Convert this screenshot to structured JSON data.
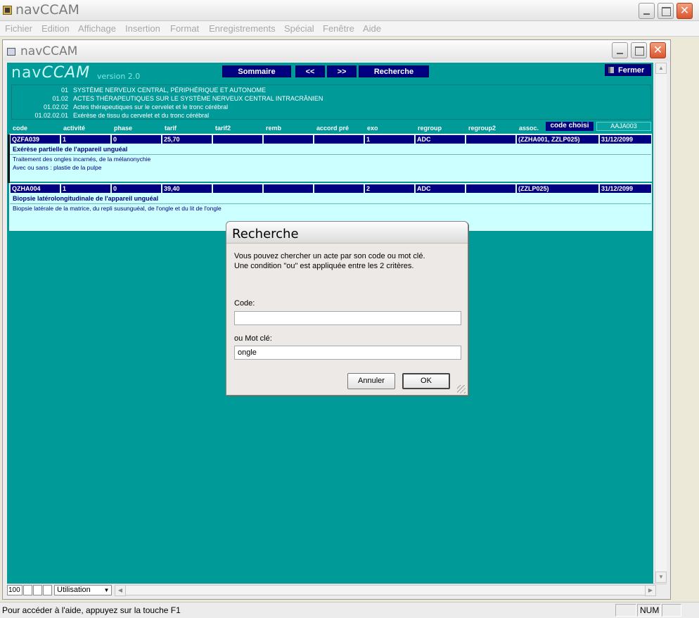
{
  "app": {
    "title": "navCCAM",
    "menu": [
      "Fichier",
      "Edition",
      "Affichage",
      "Insertion",
      "Format",
      "Enregistrements",
      "Spécial",
      "Fenêtre",
      "Aide"
    ]
  },
  "inner": {
    "title": "navCCAM"
  },
  "form": {
    "logo_left": "nav",
    "logo_right": "CCAM",
    "version": "version 2.0",
    "nav": {
      "sommaire": "Sommaire",
      "prev": "<<",
      "next": ">>",
      "recherche": "Recherche"
    },
    "fermer": "Fermer",
    "hierarchy": [
      {
        "num": "01",
        "label": "SYSTÈME NERVEUX CENTRAL, PÉRIPHÉRIQUE ET AUTONOME"
      },
      {
        "num": "01.02",
        "label": "ACTES THÉRAPEUTIQUES SUR LE SYSTÈME NERVEUX CENTRAL INTRACRÂNIEN"
      },
      {
        "num": "01.02.02",
        "label": "Actes thérapeutiques sur le cervelet et le tronc cérébral"
      },
      {
        "num": "01.02.02.01",
        "label": "Exérèse de tissu du cervelet et du tronc cérébral"
      }
    ],
    "columns": [
      "code",
      "activité",
      "phase",
      "tarif",
      "tarif2",
      "remb",
      "accord pré",
      "exo",
      "regroup",
      "regroup2",
      "assoc."
    ],
    "code_choisi_label": "code choisi",
    "code_choisi_value": "AAJA003",
    "records": [
      {
        "code": "QZFA039",
        "activite": "1",
        "phase": "0",
        "tarif": "25,70",
        "tarif2": "",
        "remb": "",
        "accord": "",
        "exo": "1",
        "regroup": "ADC",
        "regroup2": "",
        "assoc": "(ZZHA001, ZZLP025)",
        "date": "31/12/2099",
        "title": "Exérèse partielle de l'appareil unguéal",
        "desc": [
          "Traitement des ongles incarnés, de la mélanonychie",
          "Avec ou sans : plastie de la pulpe"
        ]
      },
      {
        "code": "QZHA004",
        "activite": "1",
        "phase": "0",
        "tarif": "39,40",
        "tarif2": "",
        "remb": "",
        "accord": "",
        "exo": "2",
        "regroup": "ADC",
        "regroup2": "",
        "assoc": "(ZZLP025)",
        "date": "31/12/2099",
        "title": "Biopsie latérolongitudinale de l'appareil unguéal",
        "desc": [
          "Biopsie latérale de la matrice, du repli susunguéal, de l'ongle et du lit de l'ongle"
        ]
      }
    ]
  },
  "dialog": {
    "title": "Recherche",
    "message_line1": "Vous pouvez chercher un acte par son code ou mot clé.",
    "message_line2": "Une condition \"ou\" est appliquée entre les 2 critères.",
    "code_label": "Code:",
    "code_value": "",
    "keyword_label": "ou Mot clé:",
    "keyword_value": "ongle",
    "cancel": "Annuler",
    "ok": "OK"
  },
  "bottombar": {
    "zoom": "100",
    "mode": "Utilisation"
  },
  "status": {
    "text": "Pour accéder à l'aide, appuyez sur la touche F1",
    "num": "NUM"
  }
}
